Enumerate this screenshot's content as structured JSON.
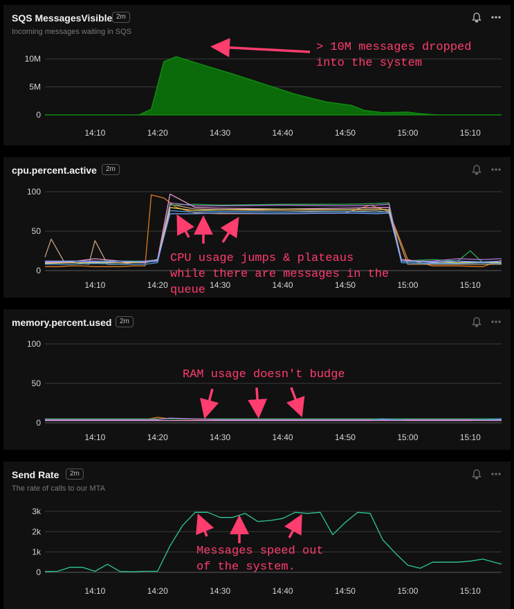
{
  "colors": {
    "accent": "#ff3d6e",
    "sqs_fill": "#0b6b0b",
    "send_rate": "#2fc79b"
  },
  "panels": [
    {
      "title": "SQS MessagesVisible",
      "badge": "2m",
      "subtitle": "Incoming messages waiting in SQS"
    },
    {
      "title": "cpu.percent.active",
      "badge": "2m",
      "subtitle": ""
    },
    {
      "title": "memory.percent.used",
      "badge": "2m",
      "subtitle": ""
    },
    {
      "title": "Send Rate",
      "badge": "2m",
      "subtitle": "The rate of calls to our MTA"
    }
  ],
  "annotations": {
    "sqs": "> 10M messages dropped\ninto the system",
    "cpu": "CPU usage jumps & plateaus\nwhile there are messages in the\nqueue",
    "mem": "RAM usage doesn't budge",
    "send": "Messages speed out\nof the system."
  },
  "chart_data": [
    {
      "type": "area",
      "title": "SQS MessagesVisible",
      "x_ticks": [
        "14:10",
        "14:20",
        "14:30",
        "14:40",
        "14:50",
        "15:00",
        "15:10"
      ],
      "y_ticks": [
        "0",
        "5M",
        "10M"
      ],
      "xlim": [
        2,
        75
      ],
      "ylim": [
        0,
        11000000
      ],
      "x_unit": "minutes after 14:00",
      "series": [
        {
          "x": [
            2,
            17,
            19,
            21,
            23,
            27,
            32,
            37,
            42,
            47,
            51,
            53,
            56,
            60,
            62,
            64,
            65,
            68,
            75
          ],
          "values": [
            0,
            0,
            1000000,
            9500000,
            10400000,
            9000000,
            7300000,
            5500000,
            3700000,
            2300000,
            1700000,
            800000,
            400000,
            500000,
            200000,
            50000,
            0,
            0,
            0
          ]
        }
      ]
    },
    {
      "type": "line",
      "title": "cpu.percent.active",
      "x_ticks": [
        "14:10",
        "14:20",
        "14:30",
        "14:40",
        "14:50",
        "15:00",
        "15:10"
      ],
      "y_ticks": [
        "0",
        "50",
        "100"
      ],
      "xlim": [
        2,
        75
      ],
      "ylim": [
        0,
        100
      ],
      "x_unit": "minutes after 14:00",
      "series": [
        {
          "color": "#e07b22",
          "x": [
            2,
            4,
            6,
            8,
            10,
            12,
            14,
            16,
            18,
            19,
            21,
            23,
            26,
            30,
            40,
            50,
            54,
            57,
            60,
            64,
            68,
            72,
            75
          ],
          "values": [
            5,
            5,
            6,
            6,
            5,
            5,
            5,
            6,
            6,
            96,
            92,
            80,
            73,
            72,
            72,
            73,
            83,
            75,
            14,
            6,
            6,
            5,
            13
          ]
        },
        {
          "color": "#c8a27a",
          "x": [
            2,
            3,
            5,
            7,
            9,
            10,
            12,
            14,
            16,
            18,
            20,
            22,
            26,
            30,
            40,
            50,
            55,
            57,
            60,
            64,
            68,
            72,
            75
          ],
          "values": [
            17,
            40,
            12,
            10,
            8,
            38,
            8,
            8,
            10,
            10,
            14,
            84,
            78,
            77,
            76,
            75,
            76,
            74,
            8,
            8,
            8,
            8,
            8
          ]
        },
        {
          "color": "#2fa84f",
          "x": [
            2,
            6,
            10,
            14,
            18,
            20,
            22,
            26,
            30,
            40,
            50,
            55,
            57,
            59,
            64,
            68,
            70,
            72,
            75
          ],
          "values": [
            12,
            12,
            12,
            12,
            12,
            14,
            83,
            84,
            83,
            84,
            84,
            85,
            86,
            12,
            14,
            12,
            25,
            10,
            12
          ]
        },
        {
          "color": "#e89ad0",
          "x": [
            2,
            6,
            10,
            14,
            18,
            20,
            22,
            26,
            30,
            40,
            50,
            55,
            57,
            59,
            64,
            68,
            72,
            75
          ],
          "values": [
            10,
            11,
            15,
            12,
            10,
            14,
            97,
            80,
            79,
            78,
            79,
            80,
            80,
            14,
            10,
            12,
            10,
            12
          ]
        },
        {
          "color": "#b07be0",
          "x": [
            2,
            6,
            10,
            14,
            18,
            20,
            22,
            26,
            30,
            40,
            50,
            55,
            57,
            59,
            64,
            68,
            72,
            75
          ],
          "values": [
            12,
            12,
            12,
            10,
            12,
            13,
            86,
            82,
            82,
            83,
            82,
            83,
            84,
            12,
            12,
            15,
            14,
            15
          ]
        },
        {
          "color": "#4aa3e8",
          "x": [
            2,
            6,
            10,
            14,
            18,
            20,
            22,
            26,
            30,
            40,
            50,
            55,
            57,
            59,
            64,
            68,
            72,
            75
          ],
          "values": [
            8,
            8,
            9,
            8,
            8,
            10,
            76,
            74,
            75,
            74,
            75,
            74,
            75,
            10,
            9,
            9,
            10,
            9
          ]
        },
        {
          "color": "#e5d36a",
          "x": [
            2,
            6,
            10,
            14,
            18,
            20,
            22,
            26,
            30,
            40,
            50,
            55,
            57,
            59,
            64,
            68,
            72,
            75
          ],
          "values": [
            9,
            10,
            10,
            10,
            11,
            12,
            80,
            76,
            77,
            78,
            77,
            78,
            77,
            12,
            11,
            10,
            11,
            10
          ]
        },
        {
          "color": "#7aa2ff",
          "x": [
            2,
            6,
            10,
            14,
            18,
            20,
            22,
            26,
            30,
            40,
            50,
            55,
            57,
            59,
            64,
            68,
            72,
            75
          ],
          "values": [
            11,
            12,
            11,
            12,
            11,
            12,
            72,
            72,
            73,
            72,
            73,
            72,
            73,
            12,
            11,
            12,
            11,
            12
          ]
        }
      ]
    },
    {
      "type": "line",
      "title": "memory.percent.used",
      "x_ticks": [
        "14:10",
        "14:20",
        "14:30",
        "14:40",
        "14:50",
        "15:00",
        "15:10"
      ],
      "y_ticks": [
        "0",
        "50",
        "100"
      ],
      "xlim": [
        2,
        75
      ],
      "ylim": [
        0,
        100
      ],
      "x_unit": "minutes after 14:00",
      "series": [
        {
          "color": "#e07b22",
          "x": [
            2,
            10,
            18,
            20,
            22,
            30,
            40,
            50,
            60,
            70,
            75
          ],
          "values": [
            4,
            4,
            4,
            7,
            5,
            4,
            4,
            4,
            4,
            4,
            4
          ]
        },
        {
          "color": "#2fa84f",
          "x": [
            2,
            10,
            20,
            30,
            40,
            50,
            60,
            70,
            75
          ],
          "values": [
            5,
            5,
            5,
            5,
            5,
            5,
            5,
            5,
            5
          ]
        },
        {
          "color": "#b07be0",
          "x": [
            2,
            10,
            20,
            22,
            30,
            40,
            50,
            60,
            70,
            75
          ],
          "values": [
            4,
            4,
            4,
            6,
            4,
            4,
            4,
            4,
            4,
            4
          ]
        },
        {
          "color": "#4aa3e8",
          "x": [
            2,
            10,
            20,
            30,
            40,
            50,
            54,
            56,
            60,
            70,
            75
          ],
          "values": [
            3,
            3,
            3,
            3,
            3,
            3,
            3,
            5,
            3,
            3,
            5
          ]
        },
        {
          "color": "#e89ad0",
          "x": [
            2,
            20,
            40,
            60,
            75
          ],
          "values": [
            3,
            3,
            3,
            3,
            3
          ]
        }
      ]
    },
    {
      "type": "line",
      "title": "Send Rate",
      "x_ticks": [
        "14:10",
        "14:20",
        "14:30",
        "14:40",
        "14:50",
        "15:00",
        "15:10"
      ],
      "y_ticks": [
        "0",
        "1k",
        "2k",
        "3k"
      ],
      "xlim": [
        2,
        75
      ],
      "ylim": [
        0,
        3200
      ],
      "x_unit": "minutes after 14:00",
      "series": [
        {
          "color": "#2fc79b",
          "x": [
            2,
            4,
            6,
            8,
            10,
            12,
            14,
            16,
            18,
            20,
            22,
            24,
            26,
            28,
            30,
            32,
            34,
            36,
            38,
            40,
            42,
            44,
            46,
            48,
            50,
            52,
            54,
            56,
            58,
            60,
            62,
            64,
            66,
            68,
            70,
            72,
            75
          ],
          "values": [
            40,
            50,
            250,
            250,
            50,
            400,
            40,
            30,
            50,
            50,
            1300,
            2300,
            2950,
            2950,
            2700,
            2700,
            2900,
            2500,
            2550,
            2650,
            2950,
            2900,
            2950,
            1850,
            2450,
            2950,
            2900,
            1600,
            950,
            350,
            200,
            500,
            500,
            500,
            550,
            650,
            400
          ]
        }
      ]
    }
  ]
}
